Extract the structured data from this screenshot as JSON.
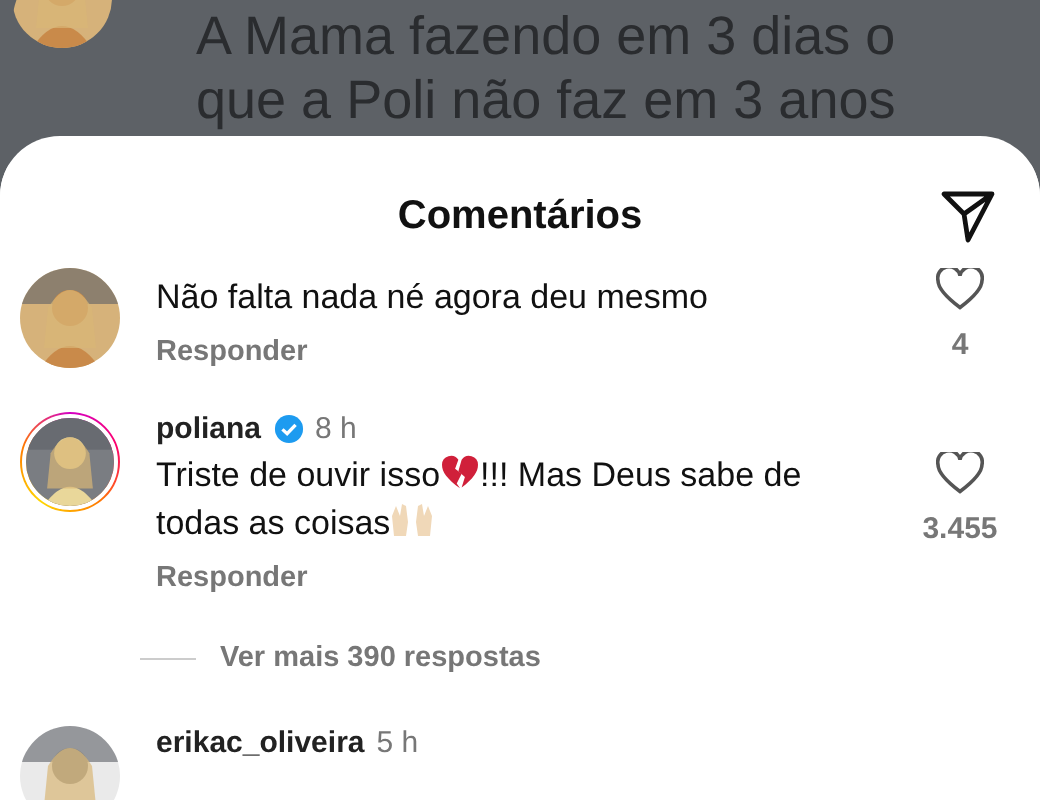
{
  "post": {
    "caption_lines": [
      "A Mama fazendo em 3 dias o",
      "que a Poli não faz em 3 anos"
    ]
  },
  "sheet": {
    "title": "Comentários"
  },
  "comments": [
    {
      "parts": [
        {
          "kind": "text",
          "text": "Não falta nada né agora deu mesmo"
        }
      ],
      "reply": "Responder",
      "likes": "4",
      "story_ring": false
    },
    {
      "username": "poliana",
      "verified": true,
      "time": "8 h",
      "parts": [
        {
          "kind": "text",
          "text": "Triste de ouvir isso"
        },
        {
          "kind": "broken_heart"
        },
        {
          "kind": "text",
          "text": "!!! Mas Deus sabe de todas as coisas"
        },
        {
          "kind": "raised_hands"
        }
      ],
      "reply": "Responder",
      "likes": "3.455",
      "story_ring": true,
      "more_replies": "Ver mais 390 respostas"
    },
    {
      "username": "erikac_oliveira",
      "time": "5 h",
      "story_ring": false
    }
  ]
}
